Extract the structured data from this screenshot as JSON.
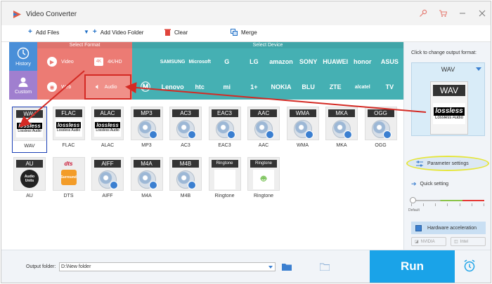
{
  "app": {
    "title": "Video Converter"
  },
  "window_controls": [
    "key-icon",
    "cart-icon",
    "minimize-icon",
    "close-icon"
  ],
  "toolbar": {
    "add_files": "Add Files",
    "add_video_folder": "Add Video Folder",
    "clear": "Clear",
    "merge": "Merge"
  },
  "tabs": {
    "history": "History",
    "custom": "Custom"
  },
  "format_section": {
    "header": "Select Format",
    "items": [
      "Video",
      "4K/HD",
      "Web",
      "Audio"
    ],
    "selected": "Audio"
  },
  "device_section": {
    "header": "Select Device",
    "row1": [
      "",
      "SAMSUNG",
      "Microsoft",
      "G",
      "LG",
      "amazon",
      "SONY",
      "HUAWEI",
      "honor",
      "ASUS"
    ],
    "row2": [
      "",
      "Lenovo",
      "htc",
      "mi",
      "1+",
      "NOKIA",
      "BLU",
      "ZTE",
      "alcatel",
      "TV"
    ]
  },
  "formats": [
    {
      "tag": "WAV",
      "label": "WAV",
      "style": "lossless",
      "selected": true
    },
    {
      "tag": "FLAC",
      "label": "FLAC",
      "style": "lossless"
    },
    {
      "tag": "ALAC",
      "label": "ALAC",
      "style": "lossless"
    },
    {
      "tag": "MP3",
      "label": "MP3",
      "style": "disc"
    },
    {
      "tag": "AC3",
      "label": "AC3",
      "style": "disc"
    },
    {
      "tag": "EAC3",
      "label": "EAC3",
      "style": "disc"
    },
    {
      "tag": "AAC",
      "label": "AAC",
      "style": "disc"
    },
    {
      "tag": "WMA",
      "label": "WMA",
      "style": "disc"
    },
    {
      "tag": "MKA",
      "label": "MKA",
      "style": "disc"
    },
    {
      "tag": "OGG",
      "label": "OGG",
      "style": "disc"
    },
    {
      "tag": "AU",
      "label": "AU",
      "style": "au"
    },
    {
      "tag": "dts",
      "label": "DTS",
      "style": "dts"
    },
    {
      "tag": "AIFF",
      "label": "AIFF",
      "style": "disc"
    },
    {
      "tag": "M4A",
      "label": "M4A",
      "style": "disc"
    },
    {
      "tag": "M4B",
      "label": "M4B",
      "style": "disc"
    },
    {
      "tag": "Ringtone",
      "label": "Ringtone",
      "style": "apple"
    },
    {
      "tag": "Ringtone",
      "label": "Ringtone",
      "style": "android"
    }
  ],
  "lossless_badge": {
    "big": "lossless",
    "small": "Lossless Audio"
  },
  "special_text": {
    "au": "Audio Units",
    "dts": "Surround"
  },
  "right_panel": {
    "hint": "Click to change output format:",
    "output_format": "WAV",
    "parameter_settings": "Parameter settings",
    "quick_setting": "Quick setting",
    "quality_level": 0.0,
    "default_label": "Default",
    "hardware_acceleration": "Hardware acceleration",
    "nvidia": "NVIDIA",
    "intel": "Intel"
  },
  "bottom": {
    "output_folder_label": "Output folder:",
    "output_folder_value": "D:\\New folder",
    "run": "Run"
  },
  "colors": {
    "format_bg": "#ec7b74",
    "device_bg": "#45b0b3",
    "history_bg": "#4a8fd8",
    "custom_bg": "#a07fcf",
    "run_bg": "#1aa3e8",
    "annotation_red": "#d42a24"
  }
}
